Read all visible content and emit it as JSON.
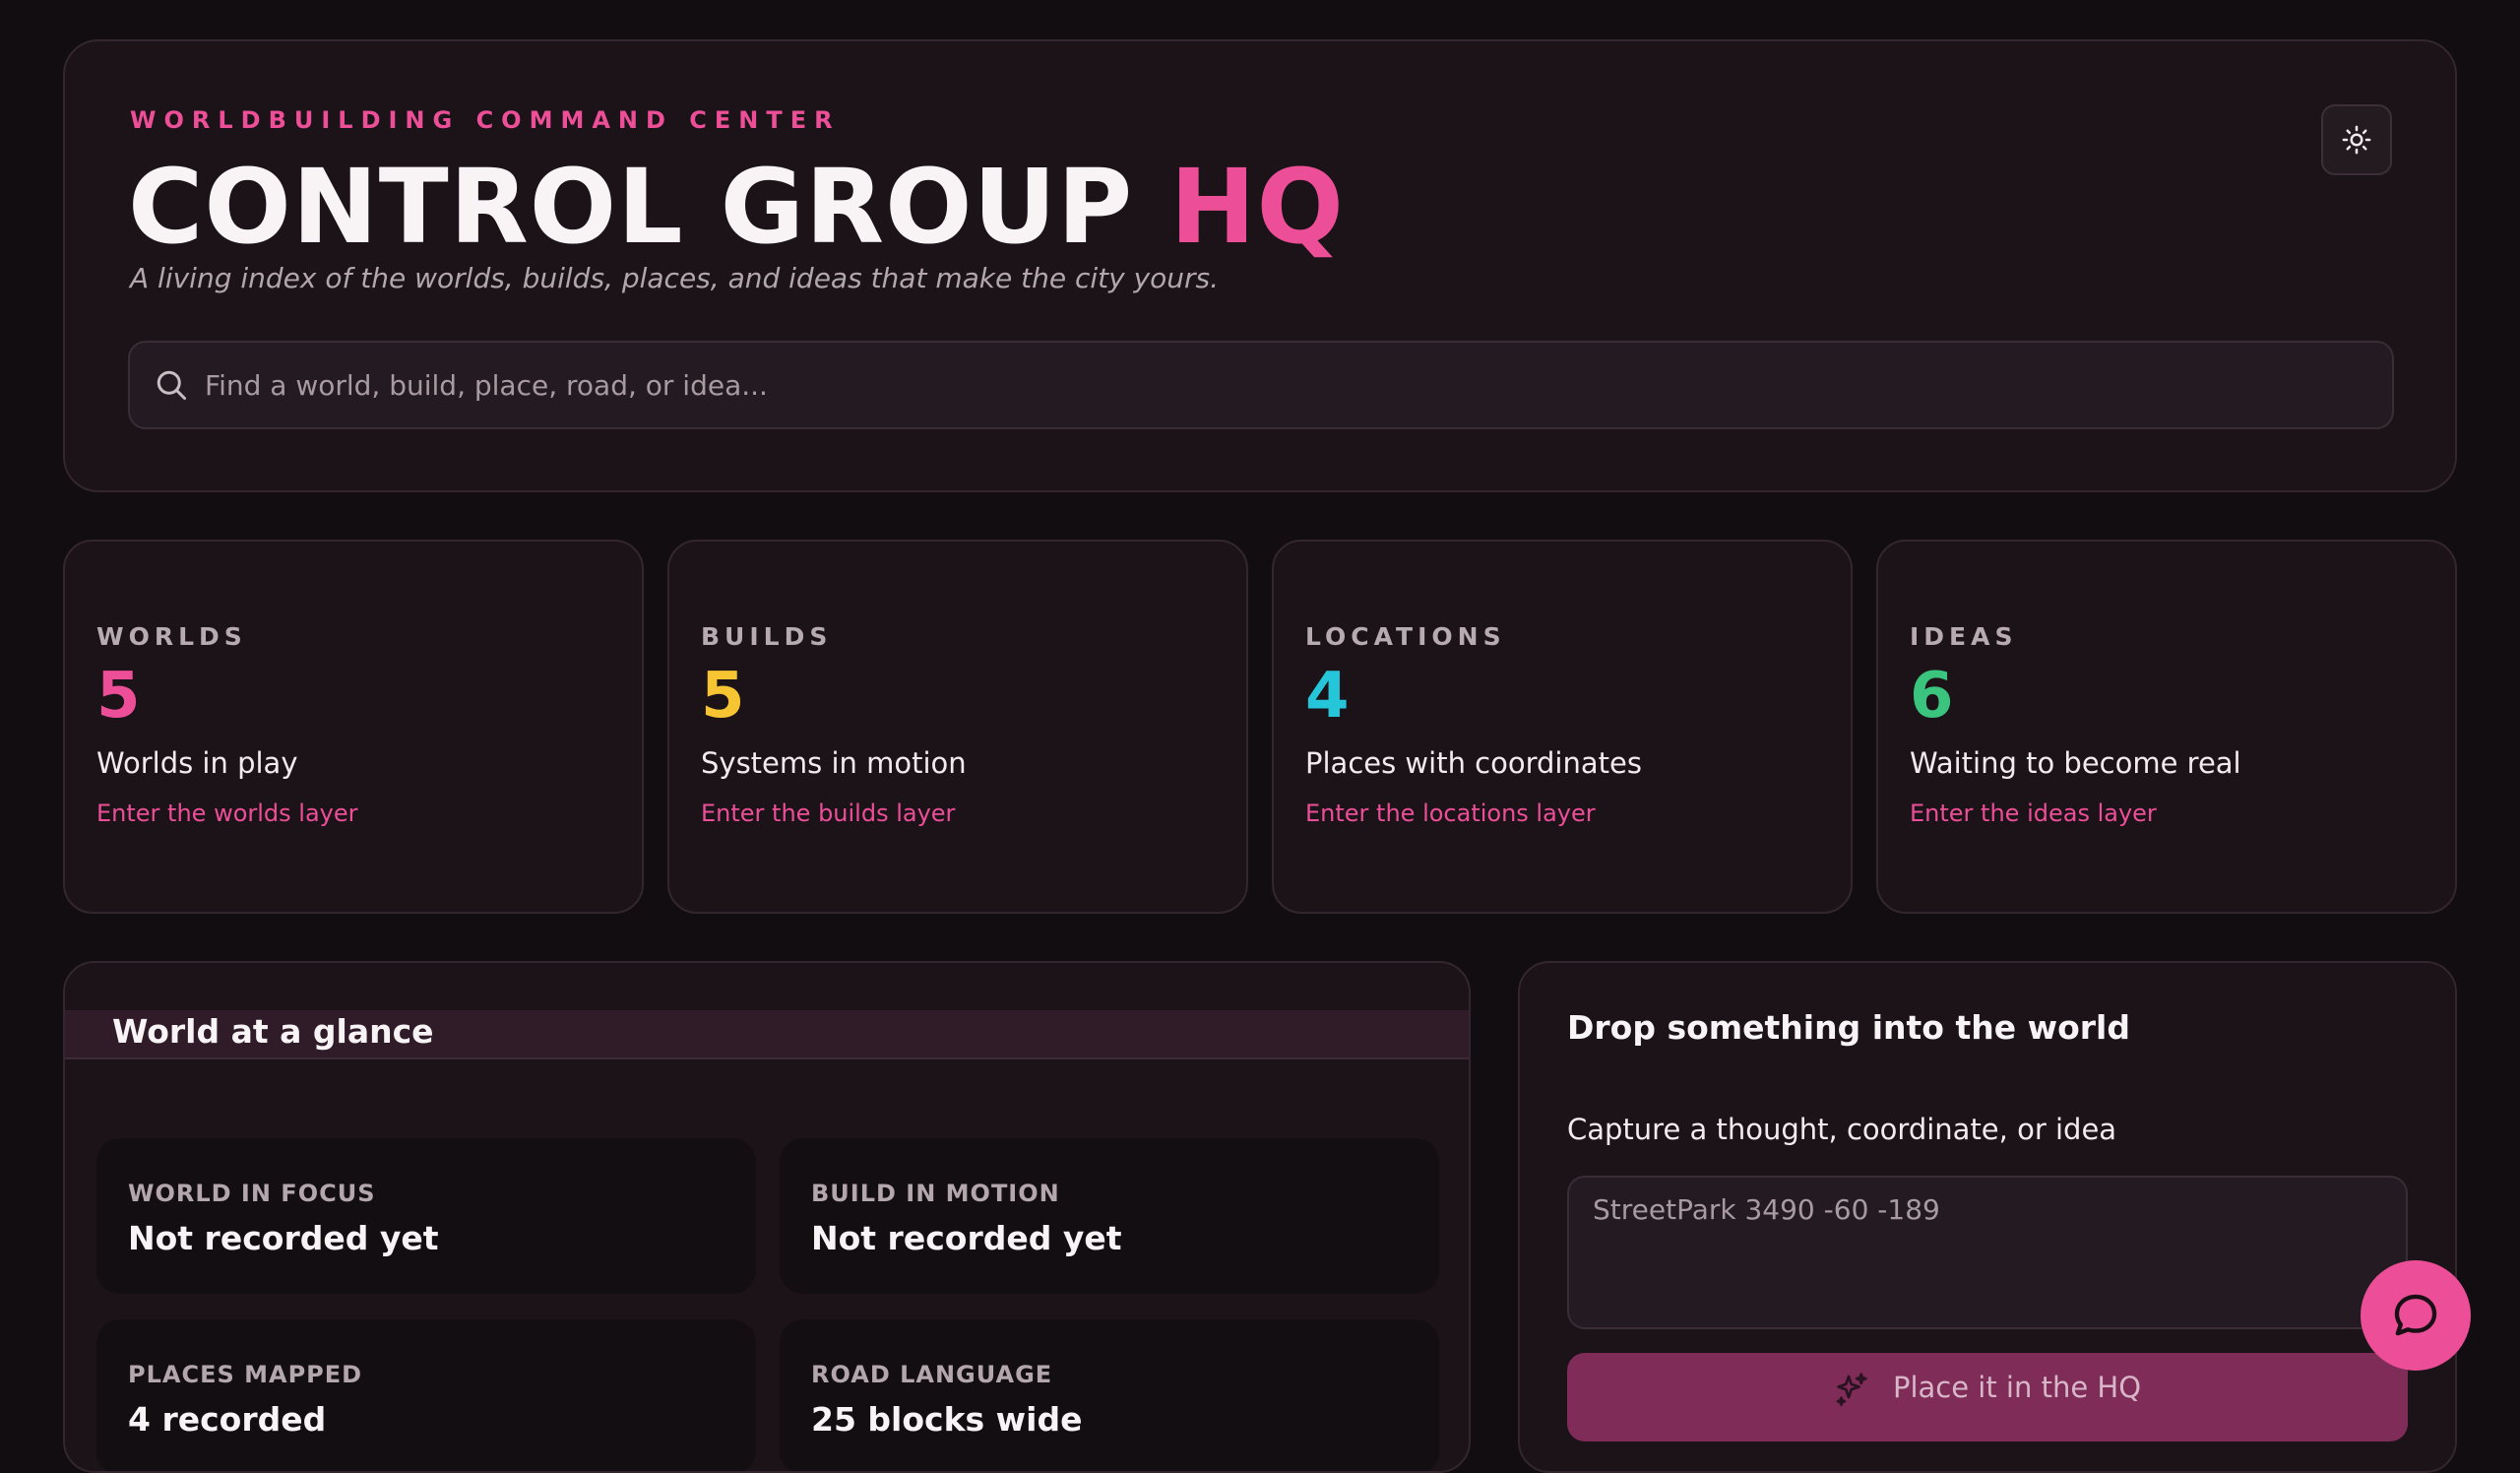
{
  "header": {
    "eyebrow": "WORLDBUILDING COMMAND CENTER",
    "title_main": "CONTROL GROUP",
    "title_accent": "HQ",
    "tagline": "A living index of the worlds, builds, places, and ideas that make the city yours.",
    "search_placeholder": "Find a world, build, place, road, or idea...",
    "theme_toggle_icon": "sun-icon"
  },
  "stats": [
    {
      "label": "WORLDS",
      "count": "5",
      "description": "Worlds in play",
      "link": "Enter the worlds layer",
      "color": "#ec4f98"
    },
    {
      "label": "BUILDS",
      "count": "5",
      "description": "Systems in motion",
      "link": "Enter the builds layer",
      "color": "#f6c531"
    },
    {
      "label": "LOCATIONS",
      "count": "4",
      "description": "Places with coordinates",
      "link": "Enter the locations layer",
      "color": "#26c6da"
    },
    {
      "label": "IDEAS",
      "count": "6",
      "description": "Waiting to become real",
      "link": "Enter the ideas layer",
      "color": "#3ac47d"
    }
  ],
  "glance": {
    "title": "World at a glance",
    "tiles": [
      {
        "label": "WORLD IN FOCUS",
        "value": "Not recorded yet"
      },
      {
        "label": "BUILD IN MOTION",
        "value": "Not recorded yet"
      },
      {
        "label": "PLACES MAPPED",
        "value": "4 recorded"
      },
      {
        "label": "ROAD LANGUAGE",
        "value": "25 blocks wide"
      }
    ]
  },
  "drop": {
    "title": "Drop something into the world",
    "caption": "Capture a thought, coordinate, or idea",
    "placeholder": "StreetPark 3490 -60 -189",
    "submit_label": "Place it in the HQ",
    "submit_icon": "sparkles-icon"
  },
  "fab": {
    "icon": "chat-bubble-icon"
  },
  "colors": {
    "accent": "#ec4f98",
    "background": "#110d10",
    "card": "#1c1319"
  }
}
